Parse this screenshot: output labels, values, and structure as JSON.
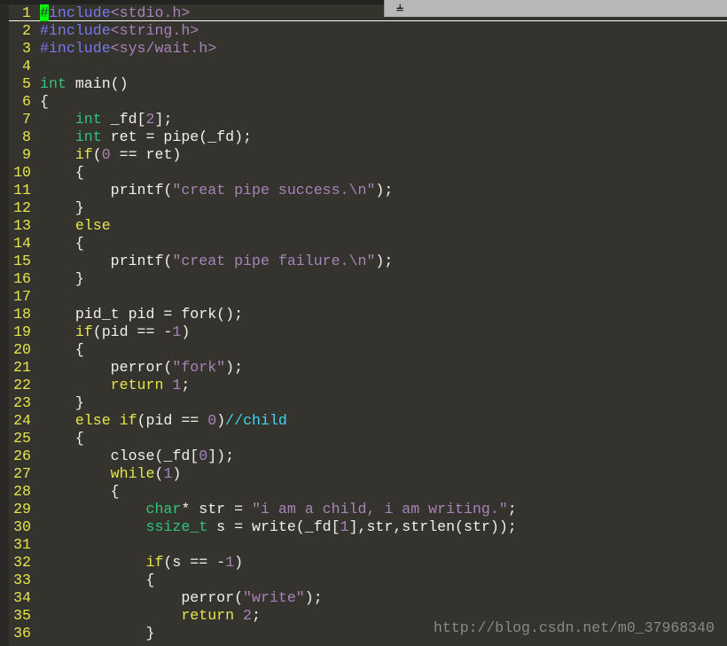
{
  "watermark": "http://blog.csdn.net/m0_37968340",
  "pin_icon": "pushpin-icon",
  "colors": {
    "background": "#35332e",
    "line_number": "#e6e64a",
    "keyword": "#e6e64a",
    "type": "#2fc47a",
    "preprocessor": "#7777ee",
    "string": "#a883b8",
    "comment": "#40d4f0",
    "cursor": "#00ff00"
  },
  "lines": [
    [
      [
        "cur",
        "#"
      ],
      [
        "pre",
        "include"
      ],
      [
        "str",
        "<stdio.h>"
      ]
    ],
    [
      [
        "pre",
        "#include"
      ],
      [
        "str",
        "<string.h>"
      ]
    ],
    [
      [
        "pre",
        "#include"
      ],
      [
        "str",
        "<sys/wait.h>"
      ]
    ],
    [],
    [
      [
        "type",
        "int"
      ],
      [
        "plain",
        " main()"
      ]
    ],
    [
      [
        "plain",
        "{"
      ]
    ],
    [
      [
        "plain",
        "    "
      ],
      [
        "type",
        "int"
      ],
      [
        "plain",
        " _fd["
      ],
      [
        "num",
        "2"
      ],
      [
        "plain",
        "];"
      ]
    ],
    [
      [
        "plain",
        "    "
      ],
      [
        "type",
        "int"
      ],
      [
        "plain",
        " ret = pipe(_fd);"
      ]
    ],
    [
      [
        "plain",
        "    "
      ],
      [
        "kw",
        "if"
      ],
      [
        "plain",
        "("
      ],
      [
        "num",
        "0"
      ],
      [
        "plain",
        " == ret)"
      ]
    ],
    [
      [
        "plain",
        "    {"
      ]
    ],
    [
      [
        "plain",
        "        printf("
      ],
      [
        "str",
        "\"creat pipe success.\\n\""
      ],
      [
        "plain",
        ");"
      ]
    ],
    [
      [
        "plain",
        "    }"
      ]
    ],
    [
      [
        "plain",
        "    "
      ],
      [
        "kw",
        "else"
      ]
    ],
    [
      [
        "plain",
        "    {"
      ]
    ],
    [
      [
        "plain",
        "        printf("
      ],
      [
        "str",
        "\"creat pipe failure.\\n\""
      ],
      [
        "plain",
        ");"
      ]
    ],
    [
      [
        "plain",
        "    }"
      ]
    ],
    [],
    [
      [
        "plain",
        "    pid_t pid = fork();"
      ]
    ],
    [
      [
        "plain",
        "    "
      ],
      [
        "kw",
        "if"
      ],
      [
        "plain",
        "(pid == -"
      ],
      [
        "num",
        "1"
      ],
      [
        "plain",
        ")"
      ]
    ],
    [
      [
        "plain",
        "    {"
      ]
    ],
    [
      [
        "plain",
        "        perror("
      ],
      [
        "str",
        "\"fork\""
      ],
      [
        "plain",
        ");"
      ]
    ],
    [
      [
        "plain",
        "        "
      ],
      [
        "kw",
        "return"
      ],
      [
        "plain",
        " "
      ],
      [
        "num",
        "1"
      ],
      [
        "plain",
        ";"
      ]
    ],
    [
      [
        "plain",
        "    }"
      ]
    ],
    [
      [
        "plain",
        "    "
      ],
      [
        "kw",
        "else if"
      ],
      [
        "plain",
        "(pid == "
      ],
      [
        "num",
        "0"
      ],
      [
        "plain",
        ")"
      ],
      [
        "cm",
        "//child"
      ]
    ],
    [
      [
        "plain",
        "    {"
      ]
    ],
    [
      [
        "plain",
        "        close(_fd["
      ],
      [
        "num",
        "0"
      ],
      [
        "plain",
        "]);"
      ]
    ],
    [
      [
        "plain",
        "        "
      ],
      [
        "kw",
        "while"
      ],
      [
        "plain",
        "("
      ],
      [
        "num",
        "1"
      ],
      [
        "plain",
        ")"
      ]
    ],
    [
      [
        "plain",
        "        {"
      ]
    ],
    [
      [
        "plain",
        "            "
      ],
      [
        "type",
        "char"
      ],
      [
        "plain",
        "* str = "
      ],
      [
        "str",
        "\"i am a child, i am writing.\""
      ],
      [
        "plain",
        ";"
      ]
    ],
    [
      [
        "plain",
        "            "
      ],
      [
        "type",
        "ssize_t"
      ],
      [
        "plain",
        " s = write(_fd["
      ],
      [
        "num",
        "1"
      ],
      [
        "plain",
        "],str,strlen(str));"
      ]
    ],
    [],
    [
      [
        "plain",
        "            "
      ],
      [
        "kw",
        "if"
      ],
      [
        "plain",
        "(s == -"
      ],
      [
        "num",
        "1"
      ],
      [
        "plain",
        ")"
      ]
    ],
    [
      [
        "plain",
        "            {"
      ]
    ],
    [
      [
        "plain",
        "                perror("
      ],
      [
        "str",
        "\"write\""
      ],
      [
        "plain",
        ");"
      ]
    ],
    [
      [
        "plain",
        "                "
      ],
      [
        "kw",
        "return"
      ],
      [
        "plain",
        " "
      ],
      [
        "num",
        "2"
      ],
      [
        "plain",
        ";"
      ]
    ],
    [
      [
        "plain",
        "            }"
      ]
    ]
  ]
}
